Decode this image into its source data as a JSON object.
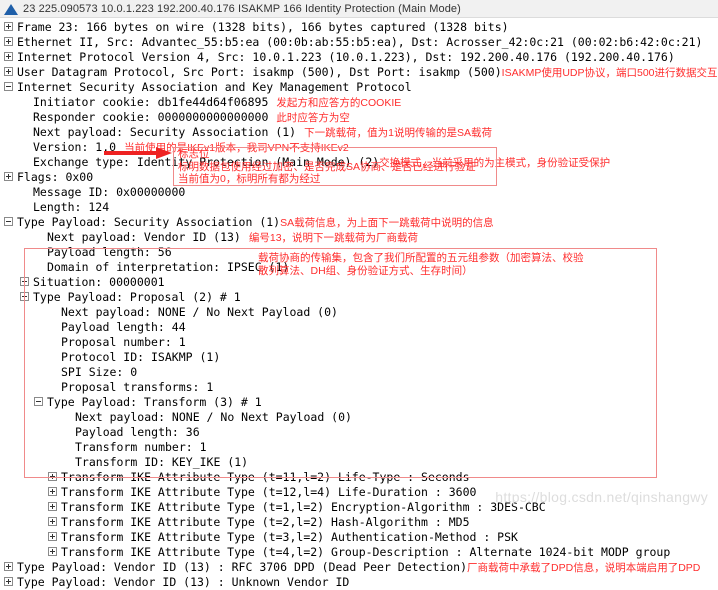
{
  "titlebar": {
    "icon": "wireshark-logo-icon",
    "summary": "23 225.090573 10.0.1.223 192.200.40.176 ISAKMP 166 Identity Protection (Main Mode)"
  },
  "colors": {
    "annotation_red": "#ff2d2d",
    "box_border_red": "#f08a8a",
    "arrow_red": "#ee2222",
    "titlebar_bg": "#f1f1f1",
    "logo_blue": "#1f5fa9"
  },
  "tree": {
    "frame": "Frame 23: 166 bytes on wire (1328 bits), 166 bytes captured (1328 bits)",
    "ethernet": "Ethernet II, Src: Advantec_55:b5:ea (00:0b:ab:55:b5:ea), Dst: Acrosser_42:0c:21 (00:02:b6:42:0c:21)",
    "ip": "Internet Protocol Version 4, Src: 10.0.1.223 (10.0.1.223), Dst: 192.200.40.176 (192.200.40.176)",
    "udp": "User Datagram Protocol, Src Port: isakmp (500), Dst Port: isakmp (500)",
    "udp_anno": "ISAKMP使用UDP协议，端口500进行数据交互",
    "isakmp": "Internet Security Association and Key Management Protocol",
    "initiator_cookie": "Initiator cookie: db1fe44d64f06895",
    "initiator_cookie_anno": "发起方和应答方的COOKIE",
    "responder_cookie": "Responder cookie: 0000000000000000",
    "responder_cookie_anno": "此时应答方为空",
    "next_payload": "Next payload: Security Association (1)",
    "next_payload_anno": "下一跳载荷，值为1说明传输的是SA载荷",
    "version": "Version: 1.0",
    "version_anno": "当前使用的是IKEv1版本，我司VPN不支持IKEv2",
    "exchange_type": "Exchange type: Identity Protection (Main Mode) (2)",
    "exchange_type_anno": "交换模式，当前采用的为主模式，身份验证受保护",
    "flags": "Flags: 0x00",
    "message_id": "Message ID: 0x00000000",
    "length": "Length: 124",
    "sa_payload": "Type Payload: Security Association (1)",
    "sa_payload_anno": "SA载荷信息，为上面下一跳载荷中说明的信息",
    "sa_next_payload": "Next payload: Vendor ID (13)",
    "sa_next_payload_anno": "编号13，说明下一跳载荷为厂商载荷",
    "sa_payload_length": "Payload length: 56",
    "sa_doi": "Domain of interpretation: IPSEC (1)",
    "sa_situation": "Situation: 00000001",
    "proposal": "Type Payload: Proposal (2) # 1",
    "proposal_next_payload": "Next payload: NONE / No Next Payload  (0)",
    "proposal_payload_length": "Payload length: 44",
    "proposal_number": "Proposal number: 1",
    "proposal_protocol_id": "Protocol ID: ISAKMP (1)",
    "proposal_spi_size": "SPI Size: 0",
    "proposal_transforms": "Proposal transforms: 1",
    "transform": "Type Payload: Transform (3) # 1",
    "transform_next_payload": "Next payload: NONE / No Next Payload  (0)",
    "transform_payload_length": "Payload length: 36",
    "transform_number": "Transform number: 1",
    "transform_id": "Transform ID: KEY_IKE (1)",
    "attr_life_type": "Transform IKE Attribute Type (t=11,l=2) Life-Type : Seconds",
    "attr_life_duration": "Transform IKE Attribute Type (t=12,l=4) Life-Duration : 3600",
    "attr_encryption": "Transform IKE Attribute Type (t=1,l=2) Encryption-Algorithm : 3DES-CBC",
    "attr_hash": "Transform IKE Attribute Type (t=2,l=2) Hash-Algorithm : MD5",
    "attr_auth": "Transform IKE Attribute Type (t=3,l=2) Authentication-Method : PSK",
    "attr_group": "Transform IKE Attribute Type (t=4,l=2) Group-Description : Alternate 1024-bit MODP group",
    "vendor_dpd": "Type Payload: Vendor ID (13) : RFC 3706 DPD (Dead Peer Detection)",
    "vendor_dpd_anno": "厂商载荷中承载了DPD信息，说明本端启用了DPD",
    "vendor_unknown": "Type Payload: Vendor ID (13) : Unknown Vendor ID"
  },
  "callouts": {
    "flags_box": {
      "line1": "标志位",
      "line2": "标明数据包使用经过加密、是否完成SA协商、是否已经进行验证",
      "line3": "当前值为0，标明所有都为经过"
    },
    "proposal_box": {
      "line1": "载荷协商的传输集，包含了我们所配置的五元组参数（加密算法、校验",
      "line2": "散列算法、DH组、身份验证方式、生存时间）"
    }
  },
  "watermark": "https://blog.csdn.net/qinshangwy"
}
